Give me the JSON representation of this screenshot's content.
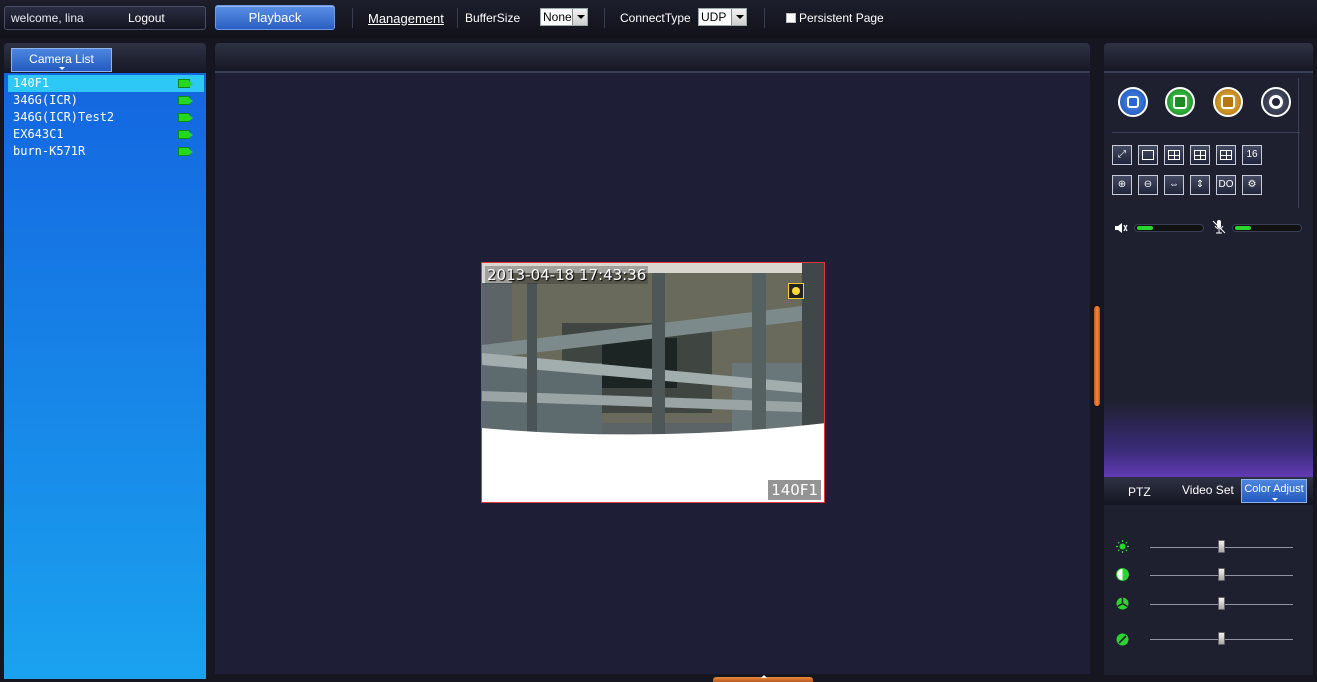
{
  "topbar": {
    "welcome": "welcome, lina",
    "logout": "Logout",
    "playback": "Playback",
    "management": "Management",
    "buffer_size_label": "BufferSize",
    "buffer_size_value": "None",
    "connect_type_label": "ConnectType",
    "connect_type_value": "UDP",
    "persistent_page": "Persistent Page"
  },
  "left": {
    "tab_label": "Camera List",
    "cameras": [
      "140F1",
      "346G(ICR)",
      "346G(ICR)Test2",
      "EX643C1",
      "burn-K571R"
    ],
    "selected_index": 0
  },
  "video": {
    "timestamp": "2013-04-18 17:43:36",
    "camera_name": "140F1"
  },
  "right": {
    "tabs": [
      "PTZ",
      "Video Set",
      "Color Adjust"
    ],
    "active_tab": "Color Adjust",
    "layout_buttons": [
      "",
      "",
      "",
      "",
      "",
      "16"
    ],
    "tool_buttons": [
      "",
      "",
      "",
      "",
      "DO",
      ""
    ],
    "adjust_sliders": [
      {
        "name": "brightness",
        "icon": "sun-icon",
        "value": 0.5
      },
      {
        "name": "contrast",
        "icon": "contrast-icon",
        "value": 0.5
      },
      {
        "name": "saturation",
        "icon": "saturation-icon",
        "value": 0.5
      },
      {
        "name": "hue",
        "icon": "hue-icon",
        "value": 0.5
      }
    ]
  },
  "colors": {
    "accent_blue": "#2a5fc2",
    "camera_list_bg": "#1a8ae8",
    "selected_row": "#2dc8f6",
    "video_border": "#e0393b",
    "green": "#2bd52f"
  }
}
